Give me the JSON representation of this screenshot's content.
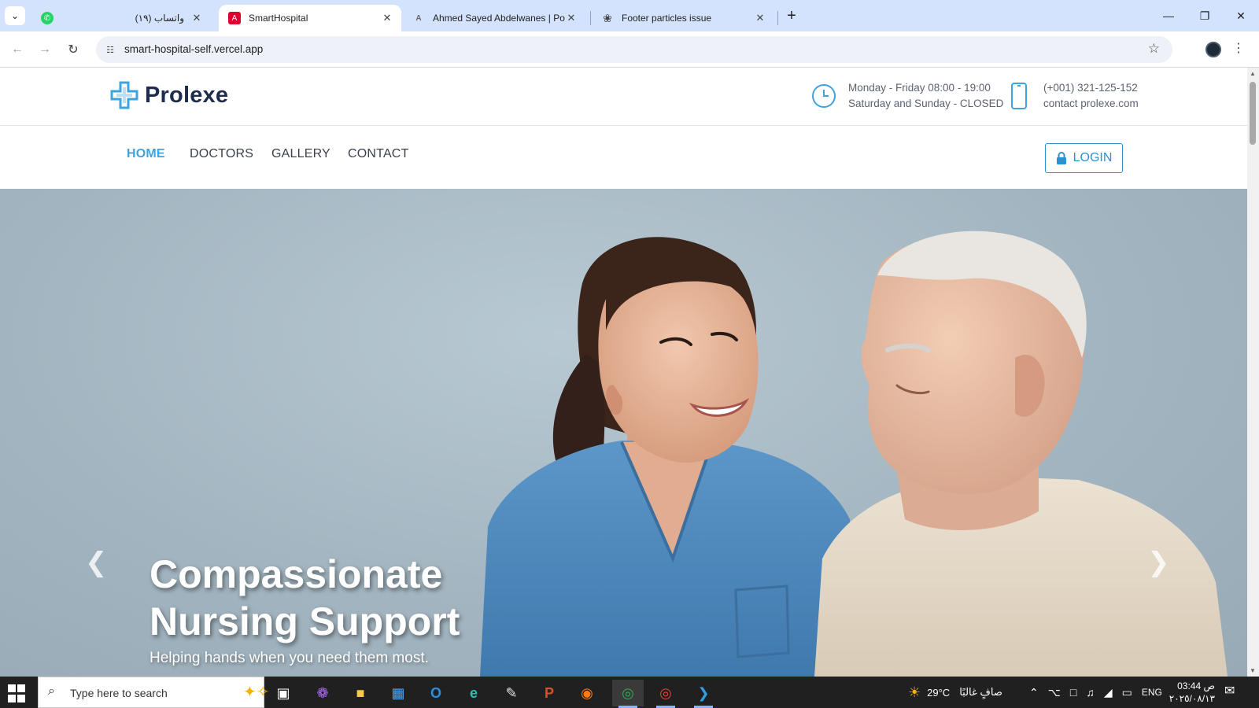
{
  "browser": {
    "tabs": [
      {
        "title": "(۱۹) واتساب",
        "favicon": "whatsapp-icon",
        "color": "#25d366"
      },
      {
        "title": "SmartHospital",
        "favicon": "angular-icon",
        "color": "#dd0031",
        "active": true
      },
      {
        "title": "Ahmed Sayed Abdelwanes | Por",
        "favicon": "letter-a-icon",
        "color": "#6b6b6b"
      },
      {
        "title": "Footer particles issue",
        "favicon": "openai-icon",
        "color": "#444444"
      }
    ],
    "url": "smart-hospital-self.vercel.app"
  },
  "site": {
    "brand": "Prolexe",
    "accent_color": "#3ea4dd",
    "hours": {
      "line1": "Monday - Friday 08:00 - 19:00",
      "line2": "Saturday and Sunday - CLOSED"
    },
    "contact": {
      "phone": "(+001) 321-125-152",
      "email": "contact prolexe.com"
    },
    "nav": [
      {
        "label": "HOME",
        "active": true
      },
      {
        "label": "DOCTORS"
      },
      {
        "label": "GALLERY"
      },
      {
        "label": "CONTACT"
      }
    ],
    "login_label": "LOGIN",
    "hero": {
      "title": "Compassionate Nursing Support",
      "subtitle": "Helping hands when you need them most."
    }
  },
  "taskbar": {
    "search_placeholder": "Type here to search",
    "weather_temp": "29°C",
    "weather_text": "صافٍ غالبًا",
    "language": "ENG",
    "time": "03:44 ص",
    "date": "۲۰۲٥/۰۸/۱۳",
    "apps": [
      "task-view-icon",
      "copilot-icon",
      "file-explorer-icon",
      "microsoft-store-icon",
      "outlook-icon",
      "edge-icon",
      "paint-icon",
      "powerpoint-icon",
      "firefox-icon",
      "chrome-icon",
      "chrome-profile-icon",
      "vscode-icon"
    ]
  }
}
